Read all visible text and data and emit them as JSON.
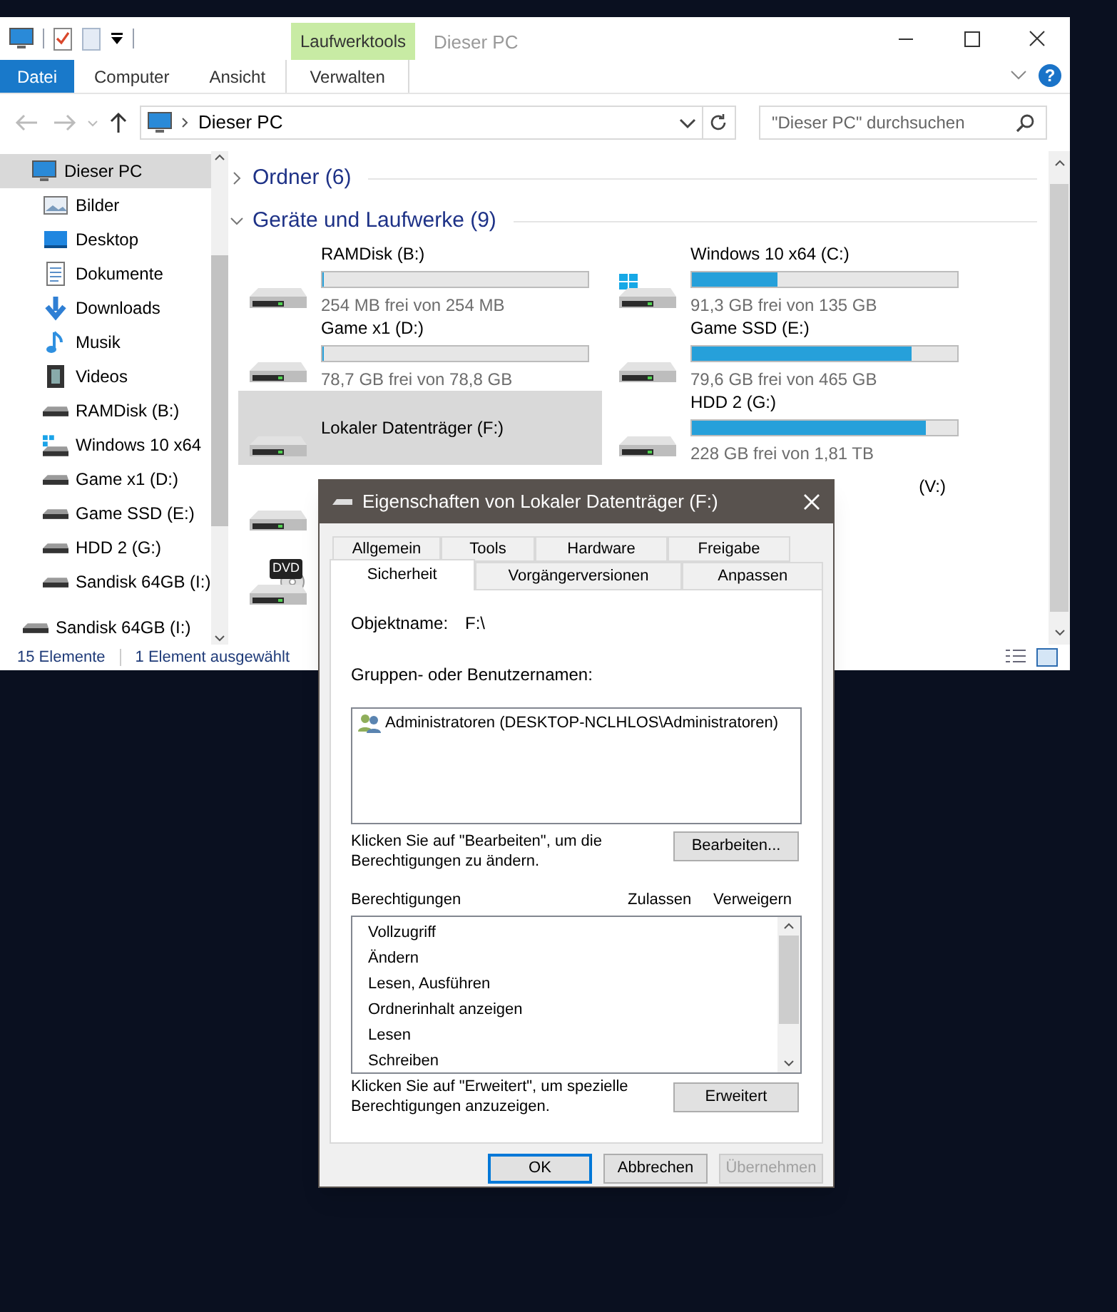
{
  "explorer": {
    "title": "Dieser PC",
    "context_tab": "Laufwerktools",
    "ribbon_tabs": [
      {
        "label": "Datei",
        "kind": "file"
      },
      {
        "label": "Computer",
        "kind": "normal"
      },
      {
        "label": "Ansicht",
        "kind": "normal"
      },
      {
        "label": "Verwalten",
        "kind": "context"
      }
    ],
    "help_glyph": "?",
    "address": {
      "path": "Dieser PC"
    },
    "search": {
      "placeholder": "\"Dieser PC\" durchsuchen"
    },
    "nav": [
      {
        "label": "Dieser PC",
        "kind": "pc",
        "selected": true,
        "children": [
          {
            "label": "Bilder",
            "kind": "pictures",
            "selected": false
          },
          {
            "label": "Desktop",
            "kind": "desktop",
            "selected": false
          },
          {
            "label": "Dokumente",
            "kind": "documents",
            "selected": false
          },
          {
            "label": "Downloads",
            "kind": "downloads",
            "selected": false
          },
          {
            "label": "Musik",
            "kind": "music",
            "selected": false
          },
          {
            "label": "Videos",
            "kind": "videos",
            "selected": false
          },
          {
            "label": "RAMDisk (B:)",
            "kind": "drive",
            "selected": false
          },
          {
            "label": "Windows 10 x64",
            "kind": "windrive",
            "selected": false
          },
          {
            "label": "Game x1 (D:)",
            "kind": "drive",
            "selected": false
          },
          {
            "label": "Game SSD (E:)",
            "kind": "drive",
            "selected": false
          },
          {
            "label": "HDD 2 (G:)",
            "kind": "drive",
            "selected": false
          },
          {
            "label": "Sandisk 64GB (I:)",
            "kind": "drive",
            "selected": false
          }
        ]
      },
      {
        "label": "Sandisk 64GB (I:)",
        "kind": "drive",
        "selected": false
      }
    ],
    "sections": [
      {
        "label": "Ordner (6)",
        "expanded": false
      },
      {
        "label": "Geräte und Laufwerke (9)",
        "expanded": true
      }
    ],
    "drives": [
      {
        "label": "RAMDisk (B:)",
        "free": "254 MB frei von 254 MB",
        "level": 0.0,
        "kind": "hdd",
        "selected": false
      },
      {
        "label": "Windows 10 x64 (C:)",
        "free": "91,3 GB frei von 135 GB",
        "level": 0.32,
        "kind": "windows",
        "selected": false
      },
      {
        "label": "Game x1 (D:)",
        "free": "78,7 GB frei von 78,8 GB",
        "level": 0.0,
        "kind": "hdd",
        "selected": false
      },
      {
        "label": "Game SSD (E:)",
        "free": "79,6 GB frei von 465 GB",
        "level": 0.83,
        "kind": "hdd",
        "selected": false
      },
      {
        "label": "Lokaler Datenträger (F:)",
        "kind": "hdd",
        "selected": true
      },
      {
        "label": "HDD 2 (G:)",
        "free": "228 GB frei von 1,81 TB",
        "level": 0.88,
        "kind": "hdd",
        "selected": false
      },
      {
        "kind": "hdd",
        "selected": false
      },
      {
        "label": "(V:)",
        "kind": "hidden"
      },
      {
        "kind": "dvd",
        "badge": "DVD",
        "selected": false
      }
    ],
    "status": {
      "count": "15 Elemente",
      "selection": "1 Element ausgewählt"
    }
  },
  "dialog": {
    "title": "Eigenschaften von Lokaler Datenträger (F:)",
    "tab_rows": [
      [
        {
          "label": "Allgemein",
          "selected": false
        },
        {
          "label": "Tools",
          "selected": false
        },
        {
          "label": "Hardware",
          "selected": false
        },
        {
          "label": "Freigabe",
          "selected": false
        }
      ],
      [
        {
          "label": "Sicherheit",
          "selected": true
        },
        {
          "label": "Vorgängerversionen",
          "selected": false
        },
        {
          "label": "Anpassen",
          "selected": false
        }
      ]
    ],
    "object_label": "Objektname:",
    "object_value": "F:\\",
    "groups_label": "Gruppen- oder Benutzernamen:",
    "users": [
      {
        "name": "Administratoren (DESKTOP-NCLHLOS\\Administratoren)"
      }
    ],
    "edit_hint": "Klicken Sie auf \"Bearbeiten\", um die Berechtigungen zu ändern.",
    "edit_button": "Bearbeiten...",
    "permissions_label": "Berechtigungen",
    "allow_label": "Zulassen",
    "deny_label": "Verweigern",
    "permissions": [
      "Vollzugriff",
      "Ändern",
      "Lesen, Ausführen",
      "Ordnerinhalt anzeigen",
      "Lesen",
      "Schreiben"
    ],
    "advanced_hint": "Klicken Sie auf \"Erweitert\", um spezielle Berechtigungen anzuzeigen.",
    "advanced_button": "Erweitert",
    "buttons": [
      {
        "label": "OK",
        "kind": "default",
        "disabled": false
      },
      {
        "label": "Abbrechen",
        "kind": "normal",
        "disabled": false
      },
      {
        "label": "Übernehmen",
        "kind": "normal",
        "disabled": true
      }
    ]
  }
}
